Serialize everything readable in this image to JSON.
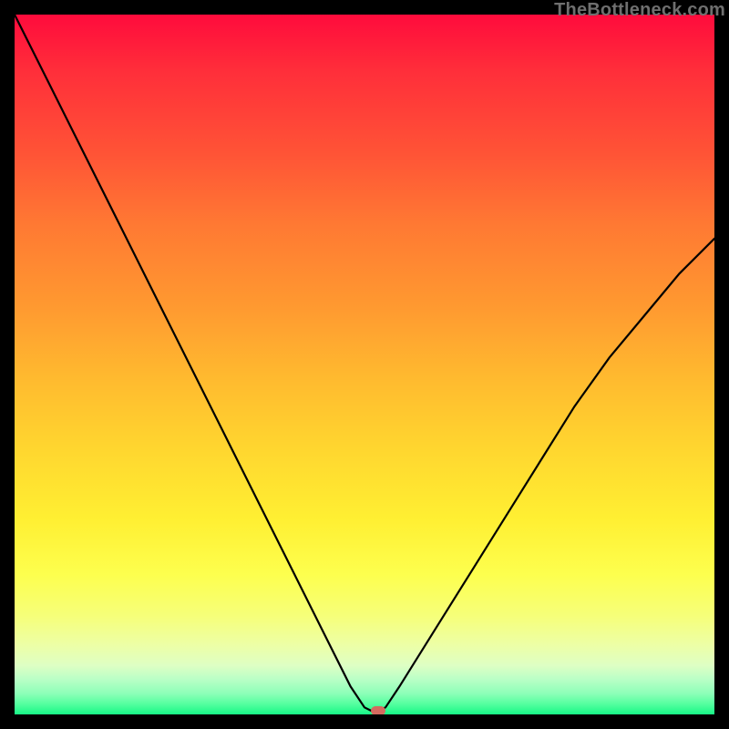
{
  "attribution": "TheBottleneck.com",
  "chart_data": {
    "type": "line",
    "title": "",
    "xlabel": "",
    "ylabel": "",
    "xlim": [
      0,
      100
    ],
    "ylim": [
      0,
      100
    ],
    "grid": false,
    "series": [
      {
        "name": "bottleneck-curve",
        "x": [
          0,
          5,
          10,
          15,
          20,
          25,
          30,
          35,
          40,
          45,
          48,
          50,
          51,
          52,
          53,
          55,
          60,
          65,
          70,
          75,
          80,
          85,
          90,
          95,
          100
        ],
        "y": [
          100,
          90,
          80,
          70,
          60,
          50,
          40,
          30,
          20,
          10,
          4,
          1,
          0.5,
          0.5,
          1,
          4,
          12,
          20,
          28,
          36,
          44,
          51,
          57,
          63,
          68
        ]
      }
    ],
    "marker": {
      "x": 52,
      "y": 0.5
    },
    "background_gradient": {
      "top": "#ff0b3c",
      "mid": "#ffe030",
      "bottom": "#17f787"
    }
  }
}
